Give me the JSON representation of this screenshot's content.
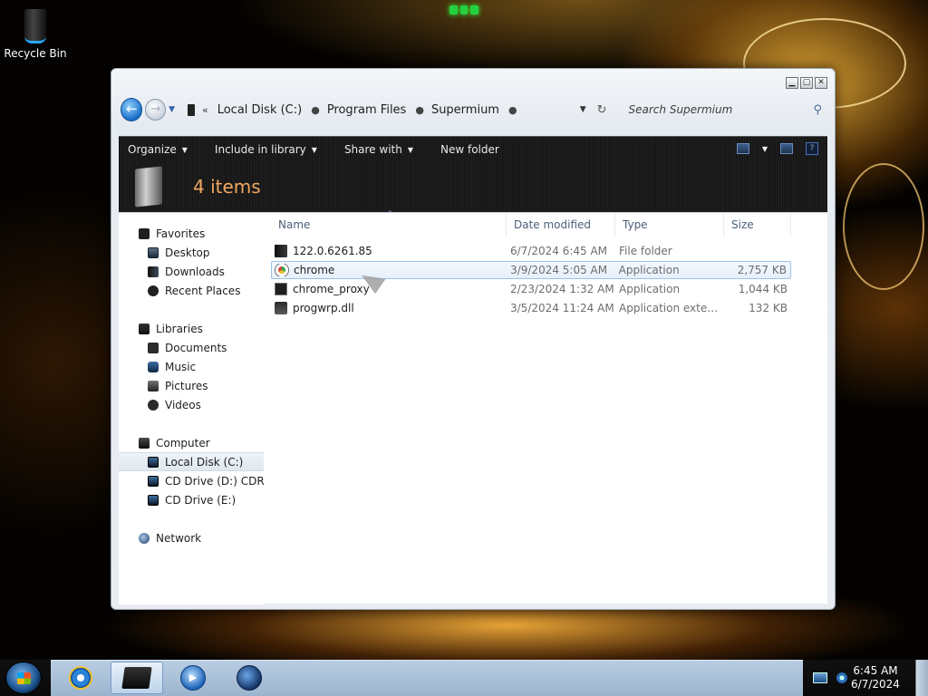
{
  "desktop": {
    "recycle_bin_label": "Recycle Bin"
  },
  "window": {
    "controls": {
      "minimize": "▁",
      "maximize": "▢",
      "close": "✕"
    },
    "nav": {
      "back_glyph": "←",
      "forward_glyph": "→",
      "history_glyph": "▼"
    },
    "address": {
      "overflow_glyph": "«",
      "crumbs": [
        "Local Disk (C:)",
        "Program Files",
        "Supermium"
      ],
      "separator": "●",
      "dropdown_glyph": "▼",
      "refresh_glyph": "↻"
    },
    "search": {
      "placeholder": "Search Supermium",
      "icon": "⚲"
    },
    "toolbar": {
      "organize": "Organize",
      "include_in_library": "Include in library",
      "share_with": "Share with",
      "new_folder": "New folder",
      "caret": "▼",
      "help": "?"
    },
    "details": {
      "items_count": "4 items"
    },
    "nav_pane": {
      "favorites": {
        "label": "Favorites",
        "items": [
          "Desktop",
          "Downloads",
          "Recent Places"
        ]
      },
      "libraries": {
        "label": "Libraries",
        "items": [
          "Documents",
          "Music",
          "Pictures",
          "Videos"
        ]
      },
      "computer": {
        "label": "Computer",
        "items": [
          "Local Disk (C:)",
          "CD Drive (D:) CDROM",
          "CD Drive (E:)"
        ],
        "selected": "Local Disk (C:)"
      },
      "network": {
        "label": "Network"
      }
    },
    "file_list": {
      "columns": [
        "Name",
        "Date modified",
        "Type",
        "Size"
      ],
      "sort_indicator": "^",
      "rows": [
        {
          "name": "122.0.6261.85",
          "date": "6/7/2024 6:45 AM",
          "type": "File folder",
          "size": "",
          "icon": "folder-icon"
        },
        {
          "name": "chrome",
          "date": "3/9/2024 5:05 AM",
          "type": "Application",
          "size": "2,757 KB",
          "icon": "chrome-icon"
        },
        {
          "name": "chrome_proxy",
          "date": "2/23/2024 1:32 AM",
          "type": "Application",
          "size": "1,044 KB",
          "icon": "application-icon"
        },
        {
          "name": "progwrp.dll",
          "date": "3/5/2024 11:24 AM",
          "type": "Application extens...",
          "size": "132 KB",
          "icon": "dll-icon"
        }
      ],
      "hovered_row": "chrome"
    }
  },
  "taskbar": {
    "clock": {
      "time": "6:45 AM",
      "date": "6/7/2024"
    },
    "apps": [
      "internet-explorer",
      "windows-explorer",
      "media-player",
      "globe"
    ],
    "active_app": "windows-explorer",
    "media_glyph": "▶"
  },
  "colors": {
    "items_count_accent": "#f0a860",
    "toolbar_text": "#eaeaea",
    "column_header_text": "#4c607a",
    "hover_row_border": "#9ec1e6",
    "taskbar_bar": "#b9cde2"
  }
}
